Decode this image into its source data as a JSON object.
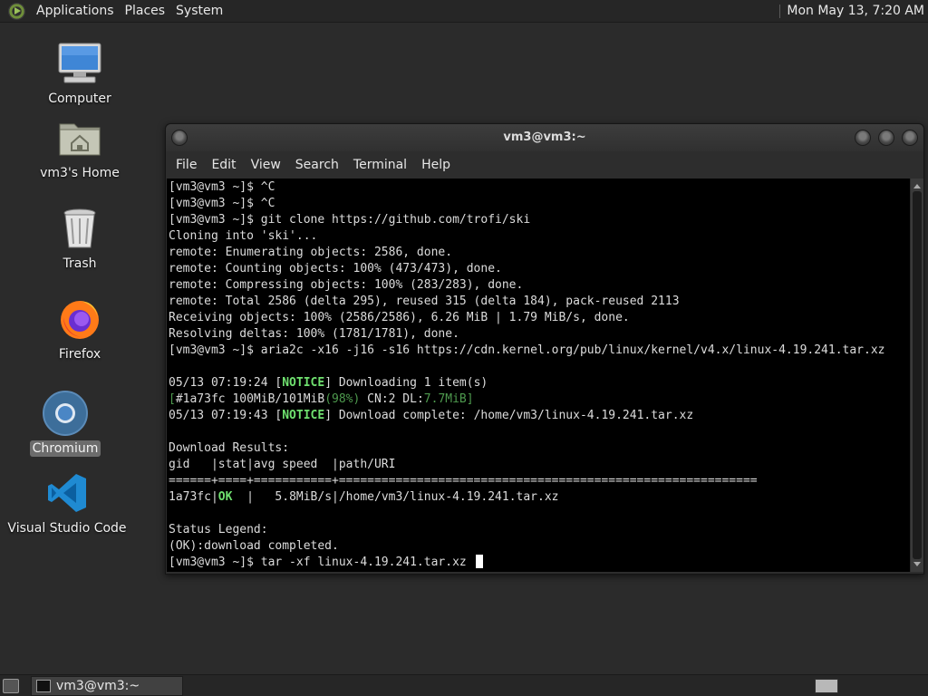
{
  "top_panel": {
    "menus": [
      "Applications",
      "Places",
      "System"
    ],
    "clock": "Mon May 13,  7:20 AM"
  },
  "desktop_icons": [
    {
      "label": "Computer",
      "icon": "computer-icon"
    },
    {
      "label": "vm3's Home",
      "icon": "home-folder-icon"
    },
    {
      "label": "Trash",
      "icon": "trash-icon"
    },
    {
      "label": "Firefox",
      "icon": "firefox-icon"
    },
    {
      "label": "Chromium",
      "icon": "chromium-icon",
      "selected": true
    },
    {
      "label": "Visual Studio Code",
      "icon": "vscode-icon"
    }
  ],
  "terminal": {
    "title": "vm3@vm3:~",
    "menus": [
      "File",
      "Edit",
      "View",
      "Search",
      "Terminal",
      "Help"
    ],
    "lines": [
      [
        {
          "t": "[vm3@vm3 ~]$ ^C"
        }
      ],
      [
        {
          "t": "[vm3@vm3 ~]$ ^C"
        }
      ],
      [
        {
          "t": "[vm3@vm3 ~]$ git clone https://github.com/trofi/ski"
        }
      ],
      [
        {
          "t": "Cloning into 'ski'..."
        }
      ],
      [
        {
          "t": "remote: Enumerating objects: 2586, done."
        }
      ],
      [
        {
          "t": "remote: Counting objects: 100% (473/473), done."
        }
      ],
      [
        {
          "t": "remote: Compressing objects: 100% (283/283), done."
        }
      ],
      [
        {
          "t": "remote: Total 2586 (delta 295), reused 315 (delta 184), pack-reused 2113"
        }
      ],
      [
        {
          "t": "Receiving objects: 100% (2586/2586), 6.26 MiB | 1.79 MiB/s, done."
        }
      ],
      [
        {
          "t": "Resolving deltas: 100% (1781/1781), done."
        }
      ],
      [
        {
          "t": "[vm3@vm3 ~]$ aria2c -x16 -j16 -s16 https://cdn.kernel.org/pub/linux/kernel/v4.x/linux-4.19.241.tar.xz"
        }
      ],
      [
        {
          "t": ""
        }
      ],
      [
        {
          "t": "05/13 07:19:24 ["
        },
        {
          "t": "NOTICE",
          "c": "notice"
        },
        {
          "t": "] Downloading 1 item(s)"
        }
      ],
      [
        {
          "t": "[",
          "c": "dim"
        },
        {
          "t": "#1a73fc 100MiB/101MiB"
        },
        {
          "t": "(98%)",
          "c": "dim"
        },
        {
          "t": " CN:2 DL:"
        },
        {
          "t": "7.7MiB",
          "c": "dim"
        },
        {
          "t": "]",
          "c": "dim"
        }
      ],
      [
        {
          "t": "05/13 07:19:43 ["
        },
        {
          "t": "NOTICE",
          "c": "notice"
        },
        {
          "t": "] Download complete: /home/vm3/linux-4.19.241.tar.xz"
        }
      ],
      [
        {
          "t": ""
        }
      ],
      [
        {
          "t": "Download Results:"
        }
      ],
      [
        {
          "t": "gid   |stat|avg speed  |path/URI"
        }
      ],
      [
        {
          "t": "======+====+===========+==========================================================="
        }
      ],
      [
        {
          "t": "1a73fc|"
        },
        {
          "t": "OK",
          "c": "ok"
        },
        {
          "t": "  |   5.8MiB/s|/home/vm3/linux-4.19.241.tar.xz"
        }
      ],
      [
        {
          "t": ""
        }
      ],
      [
        {
          "t": "Status Legend:"
        }
      ],
      [
        {
          "t": "(OK):download completed."
        }
      ],
      [
        {
          "t": "[vm3@vm3 ~]$ tar -xf linux-4.19.241.tar.xz "
        },
        {
          "cursor": true
        }
      ]
    ]
  },
  "taskbar": {
    "task_label": "vm3@vm3:~"
  }
}
